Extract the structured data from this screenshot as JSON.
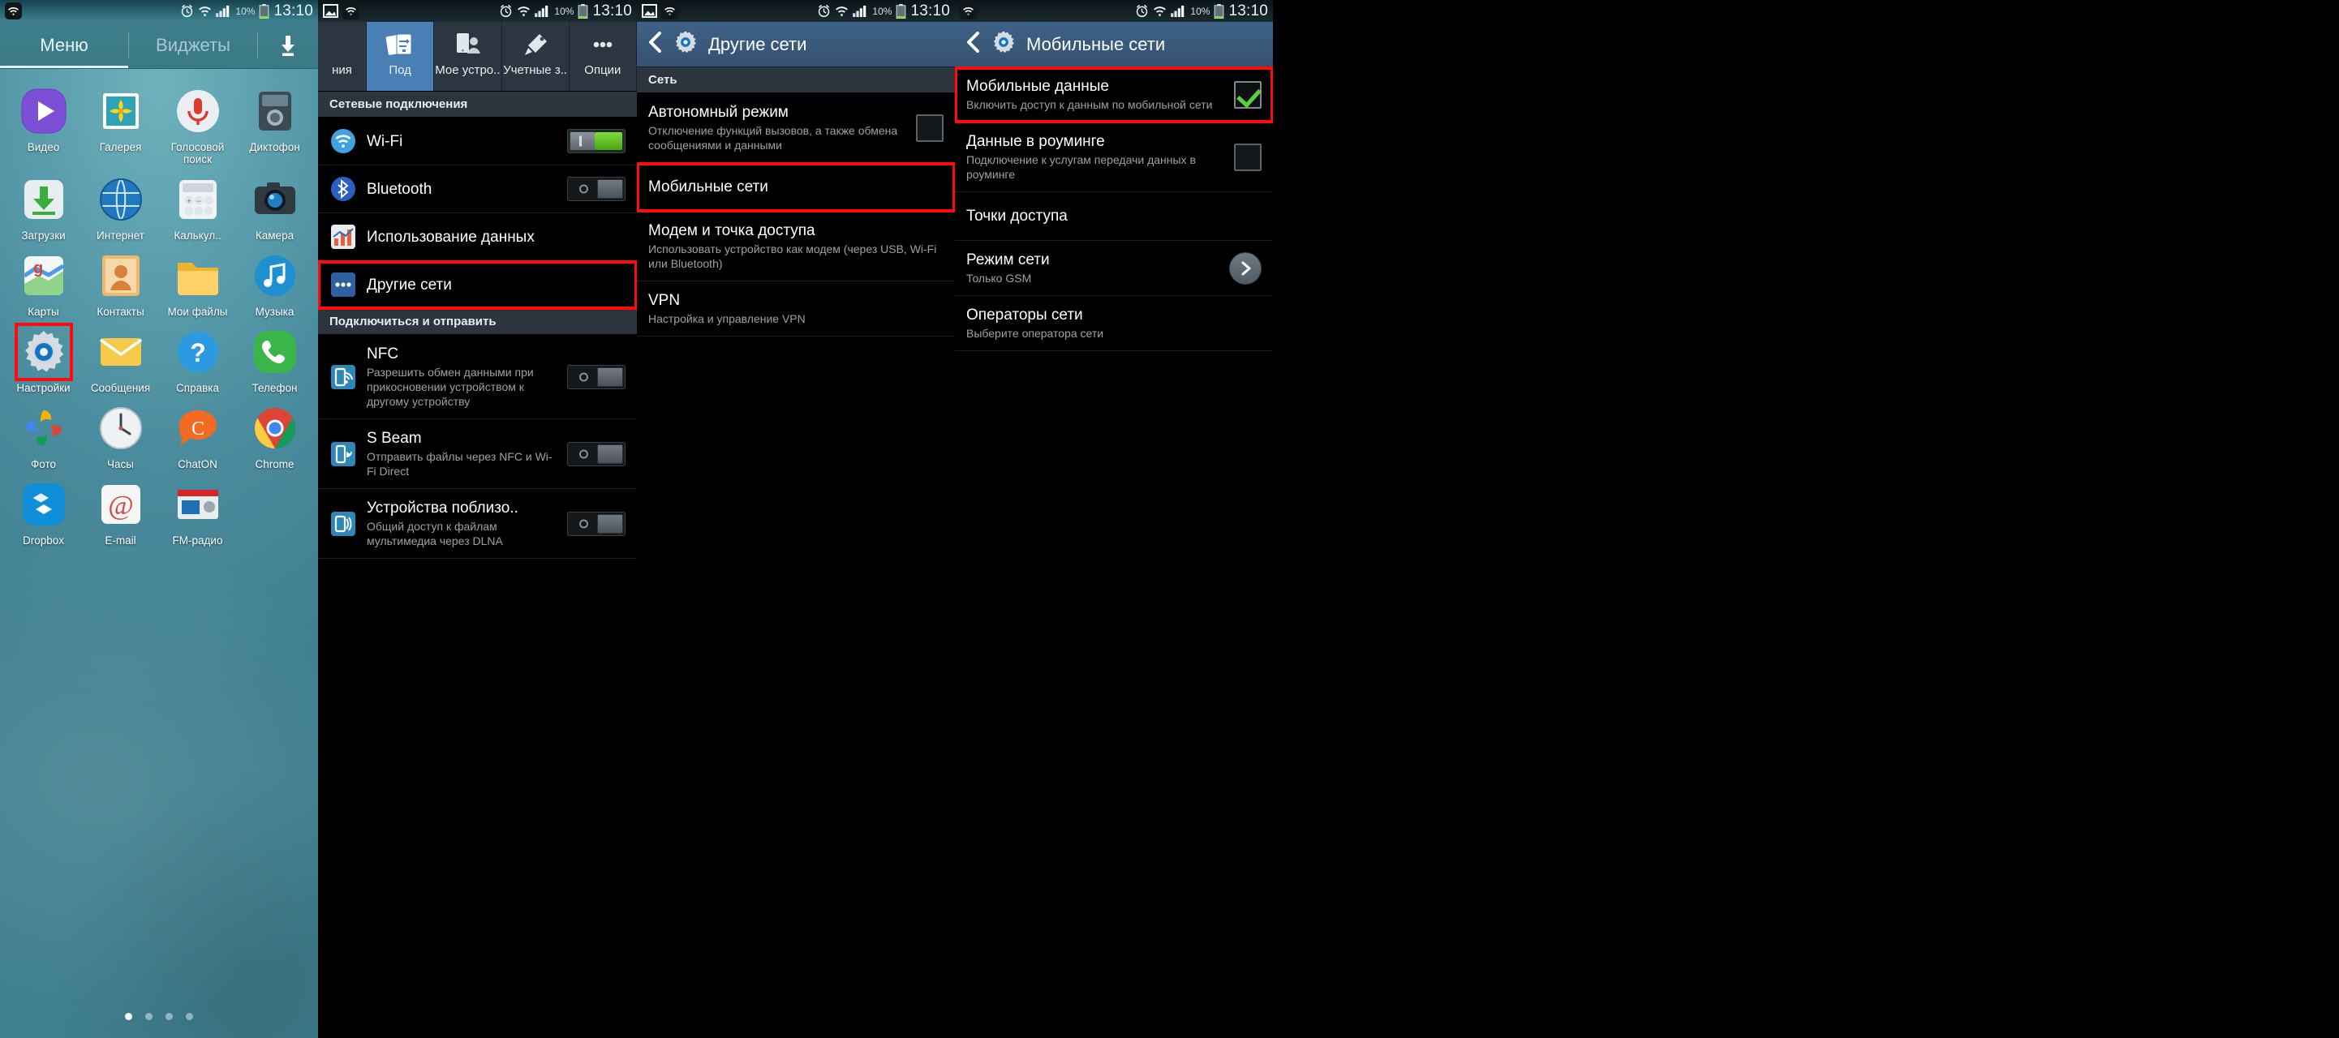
{
  "statusbar": {
    "time": "13:10",
    "battery_pct": "10%",
    "icons": [
      "alarm-icon",
      "wifi-icon",
      "signal-icon",
      "battery-icon"
    ]
  },
  "panel1": {
    "name": "home-apps-screen",
    "tabs": [
      {
        "label": "Меню",
        "active": true
      },
      {
        "label": "Виджеты",
        "active": false
      }
    ],
    "download_icon": "download-icon",
    "apps": [
      {
        "label": "Видео",
        "icon": "video-player-icon",
        "selected": false
      },
      {
        "label": "Галерея",
        "icon": "gallery-icon",
        "selected": false
      },
      {
        "label": "Голосовой поиск",
        "icon": "voice-search-icon",
        "selected": false
      },
      {
        "label": "Диктофон",
        "icon": "voice-recorder-icon",
        "selected": false
      },
      {
        "label": "Загрузки",
        "icon": "downloads-icon",
        "selected": false
      },
      {
        "label": "Интернет",
        "icon": "internet-browser-icon",
        "selected": false
      },
      {
        "label": "Калькул..",
        "icon": "calculator-icon",
        "selected": false
      },
      {
        "label": "Камера",
        "icon": "camera-icon",
        "selected": false
      },
      {
        "label": "Карты",
        "icon": "maps-icon",
        "selected": false
      },
      {
        "label": "Контакты",
        "icon": "contacts-icon",
        "selected": false
      },
      {
        "label": "Мои файлы",
        "icon": "my-files-icon",
        "selected": false
      },
      {
        "label": "Музыка",
        "icon": "music-icon",
        "selected": false
      },
      {
        "label": "Настройки",
        "icon": "settings-gear-icon",
        "selected": true
      },
      {
        "label": "Сообщения",
        "icon": "messages-icon",
        "selected": false
      },
      {
        "label": "Справка",
        "icon": "help-icon",
        "selected": false
      },
      {
        "label": "Телефон",
        "icon": "phone-icon",
        "selected": false
      },
      {
        "label": "Фото",
        "icon": "photos-icon",
        "selected": false
      },
      {
        "label": "Часы",
        "icon": "clock-icon",
        "selected": false
      },
      {
        "label": "ChatON",
        "icon": "chaton-icon",
        "selected": false
      },
      {
        "label": "Chrome",
        "icon": "chrome-icon",
        "selected": false
      },
      {
        "label": "Dropbox",
        "icon": "dropbox-icon",
        "selected": false
      },
      {
        "label": "E-mail",
        "icon": "email-icon",
        "selected": false
      },
      {
        "label": "FM-радио",
        "icon": "fm-radio-icon",
        "selected": false
      }
    ],
    "page_dots": {
      "count": 4,
      "active_index": 0
    }
  },
  "panel2": {
    "name": "settings-connections-screen",
    "tabs": [
      {
        "label": "ния",
        "icon": "connections-icon",
        "active": false,
        "partial": true
      },
      {
        "label": "Под",
        "icon": "connections-icon",
        "active": true,
        "partial": false
      },
      {
        "label": "Мое устро..",
        "icon": "my-device-icon",
        "active": false,
        "partial": false
      },
      {
        "label": "Учетные з..",
        "icon": "accounts-icon",
        "active": false,
        "partial": false
      },
      {
        "label": "Опции",
        "icon": "more-options-icon",
        "active": false,
        "partial": false
      }
    ],
    "sections": [
      {
        "header": "Сетевые подключения",
        "items": [
          {
            "title": "Wi-Fi",
            "sub": "",
            "icon": "wifi-icon",
            "control": "toggle-on",
            "highlight": false
          },
          {
            "title": "Bluetooth",
            "sub": "",
            "icon": "bluetooth-icon",
            "control": "toggle-off",
            "highlight": false
          },
          {
            "title": "Использование данных",
            "sub": "",
            "icon": "data-usage-icon",
            "control": "none",
            "highlight": false
          },
          {
            "title": "Другие сети",
            "sub": "",
            "icon": "more-networks-icon",
            "control": "none",
            "highlight": true
          }
        ]
      },
      {
        "header": "Подключиться и отправить",
        "items": [
          {
            "title": "NFC",
            "sub": "Разрешить обмен данными при прикосновении устройством к другому устройству",
            "icon": "nfc-icon",
            "control": "toggle-off",
            "highlight": false
          },
          {
            "title": "S Beam",
            "sub": "Отправить файлы через NFC и Wi-Fi Direct",
            "icon": "s-beam-icon",
            "control": "toggle-off",
            "highlight": false
          },
          {
            "title": "Устройства поблизо..",
            "sub": "Общий доступ к файлам мультимедиа через DLNA",
            "icon": "nearby-devices-icon",
            "control": "toggle-off",
            "highlight": false
          }
        ]
      }
    ]
  },
  "panel3": {
    "name": "other-networks-screen",
    "back_icon": "back-chevron-icon",
    "app_icon": "settings-gear-icon",
    "title": "Другие сети",
    "sections": [
      {
        "header": "Сеть",
        "items": [
          {
            "title": "Автономный режим",
            "sub": "Отключение функций вызовов, а также обмена сообщениями и данными",
            "control": "checkbox-unchecked",
            "highlight": false
          },
          {
            "title": "Мобильные сети",
            "sub": "",
            "control": "none",
            "highlight": true
          },
          {
            "title": "Модем и точка доступа",
            "sub": "Использовать устройство как модем (через USB, Wi-Fi или Bluetooth)",
            "control": "none",
            "highlight": false
          },
          {
            "title": "VPN",
            "sub": "Настройка и управление VPN",
            "control": "none",
            "highlight": false
          }
        ]
      }
    ]
  },
  "panel4": {
    "name": "mobile-networks-screen",
    "back_icon": "back-chevron-icon",
    "app_icon": "settings-gear-icon",
    "title": "Мобильные сети",
    "items": [
      {
        "title": "Мобильные данные",
        "sub": "Включить доступ к данным по мобильной сети",
        "control": "checkbox-checked",
        "highlight": true
      },
      {
        "title": "Данные в роуминге",
        "sub": "Подключение к услугам передачи данных в роуминге",
        "control": "checkbox-unchecked",
        "highlight": false
      },
      {
        "title": "Точки доступа",
        "sub": "",
        "control": "none",
        "highlight": false
      },
      {
        "title": "Режим сети",
        "sub": "Только GSM",
        "control": "chevron",
        "highlight": false
      },
      {
        "title": "Операторы сети",
        "sub": "Выберите оператора сети",
        "control": "none",
        "highlight": false
      }
    ]
  },
  "colors": {
    "highlight_red": "#ff0b0b",
    "accent_blue": "#4a7fb5",
    "toggle_green": "#6fd22e",
    "check_green": "#5ad13a"
  }
}
